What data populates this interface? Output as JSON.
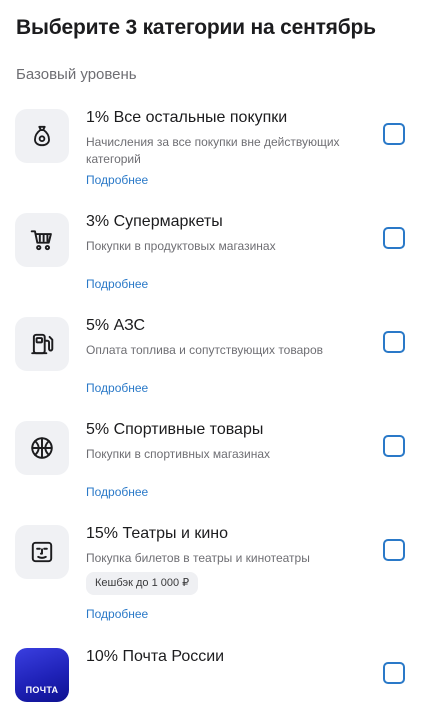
{
  "header": {
    "title": "Выберите 3 категории на сентябрь"
  },
  "section": {
    "title": "Базовый уровень"
  },
  "categories": [
    {
      "title": "1% Все остальные покупки",
      "description": "Начисления за все покупки вне действующих категорий",
      "link": "Подробнее",
      "icon": "money-bag-icon",
      "checked": false
    },
    {
      "title": "3% Супермаркеты",
      "description": "Покупки в продуктовых магазинах",
      "link": "Подробнее",
      "icon": "shopping-cart-icon",
      "checked": false
    },
    {
      "title": "5% АЗС",
      "description": "Оплата топлива и сопутствующих товаров",
      "link": "Подробнее",
      "icon": "fuel-pump-icon",
      "checked": false
    },
    {
      "title": "5% Спортивные товары",
      "description": "Покупки в спортивных магазинах",
      "link": "Подробнее",
      "icon": "basketball-icon",
      "checked": false
    },
    {
      "title": "15% Театры и кино",
      "description": "Покупка билетов в театры и кинотеатры",
      "badge": "Кешбэк до 1 000 ₽",
      "link": "Подробнее",
      "icon": "theater-mask-icon",
      "checked": false
    },
    {
      "title": "10% Почта России",
      "logo_text": "почта",
      "icon": "pochta-logo-icon",
      "checked": false
    }
  ],
  "colors": {
    "accent": "#2a79c8",
    "icon_background": "#f0f1f4",
    "secondary_text": "#6e6e73",
    "pochta_brand": "#2326c4"
  }
}
